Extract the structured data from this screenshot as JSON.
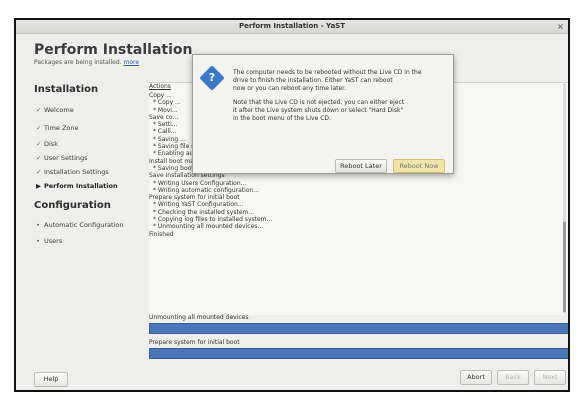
{
  "window": {
    "title": "Perform Installation - YaST",
    "close": "×"
  },
  "header": {
    "title": "Perform Installation",
    "subtitle": "Packages are being installed.",
    "more_link": "more"
  },
  "sidebar": {
    "installation_heading": "Installation",
    "steps": [
      {
        "label": "Welcome",
        "mark": "✓"
      },
      {
        "label": "Time Zone",
        "mark": "✓"
      },
      {
        "label": "Disk",
        "mark": "✓"
      },
      {
        "label": "User Settings",
        "mark": "✓"
      },
      {
        "label": "Installation Settings",
        "mark": "✓"
      },
      {
        "label": "Perform Installation",
        "mark": "▶"
      }
    ],
    "configuration_heading": "Configuration",
    "config_items": [
      {
        "label": "Automatic Configuration",
        "mark": "•"
      },
      {
        "label": "Users",
        "mark": "•"
      }
    ]
  },
  "log": {
    "column_header": "Actions",
    "lines": [
      "Copy ...",
      "* Copy ...",
      "* Movi...",
      "Save co...",
      "* Setti...",
      "* Calli...",
      "* Saving ...",
      "* Saving file system configuration...",
      "* Enabling automatic random number generator...",
      "Install boot manager",
      "* Saving bootloader configuration...",
      "Save installation settings",
      "* Writing Users Configuration...",
      "* Writing automatic configuration...",
      "Prepare system for initial boot",
      "* Writing YaST Configuration...",
      "* Checking the installed system...",
      "* Copying log files to installed system...",
      "* Unmounting all mounted devices...",
      "Finished"
    ]
  },
  "progress": [
    {
      "label": "Unmounting all mounted devices",
      "value": 1.0
    },
    {
      "label": "Prepare system for initial boot",
      "value": 1.0
    }
  ],
  "buttons": {
    "help": "Help",
    "abort": "Abort",
    "back": "Back",
    "next": "Next"
  },
  "dialog": {
    "icon": "question-icon",
    "icon_glyph": "?",
    "paragraph1": [
      "The computer needs to be rebooted without the Live CD in the",
      "drive to finish the installation. Either YaST can reboot",
      "now or you can reboot any time later."
    ],
    "paragraph2": [
      "Note that the Live CD is not ejected, you can either eject",
      "it after the Live system shuts down or select \"Hard Disk\"",
      "in the boot menu of the Live CD."
    ],
    "reboot_later": "Reboot Later",
    "reboot_now": "Reboot Now"
  },
  "colors": {
    "progress": "#4a76b8",
    "focus_button": "#f0e4a8",
    "link": "#2a5db0"
  }
}
